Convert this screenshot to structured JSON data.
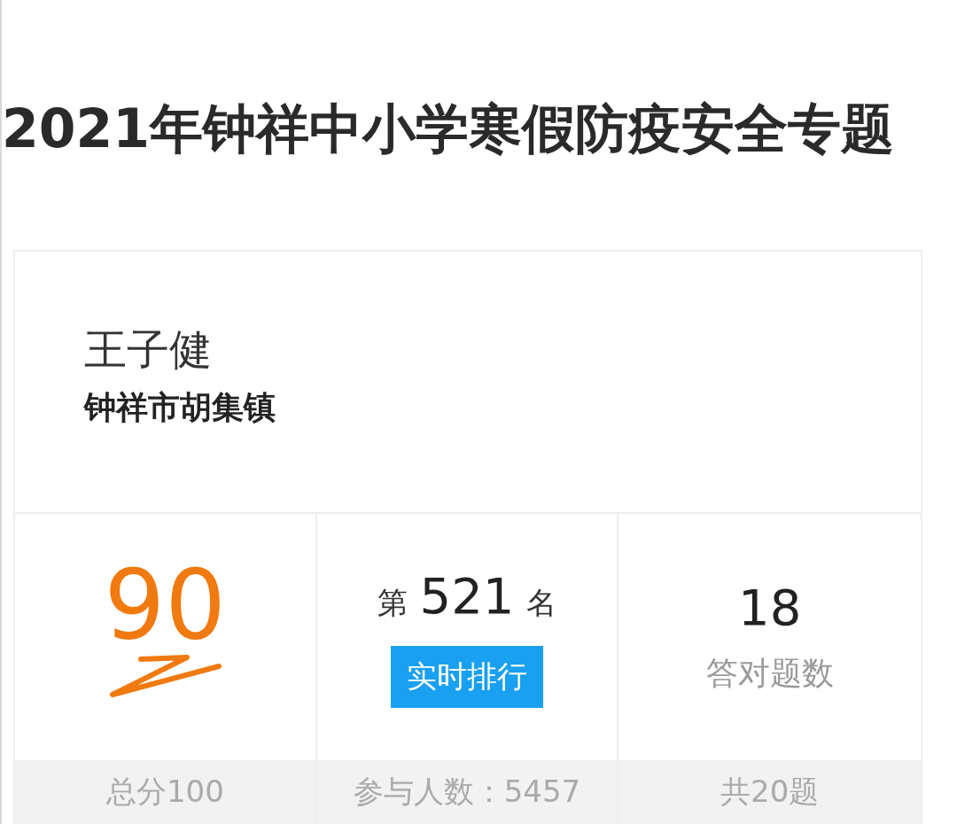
{
  "title": "2021年钟祥中小学寒假防疫安全专题",
  "person": {
    "name": "王子健",
    "location": "钟祥市胡集镇"
  },
  "stats": [
    {
      "kind": "score",
      "value": "90",
      "footer": "总分100"
    },
    {
      "kind": "rank",
      "prefix": "第",
      "value": "521",
      "suffix": "名",
      "button": "实时排行",
      "footer": "参与人数：5457"
    },
    {
      "kind": "count",
      "value": "18",
      "label": "答对题数",
      "footer": "共20题"
    }
  ]
}
